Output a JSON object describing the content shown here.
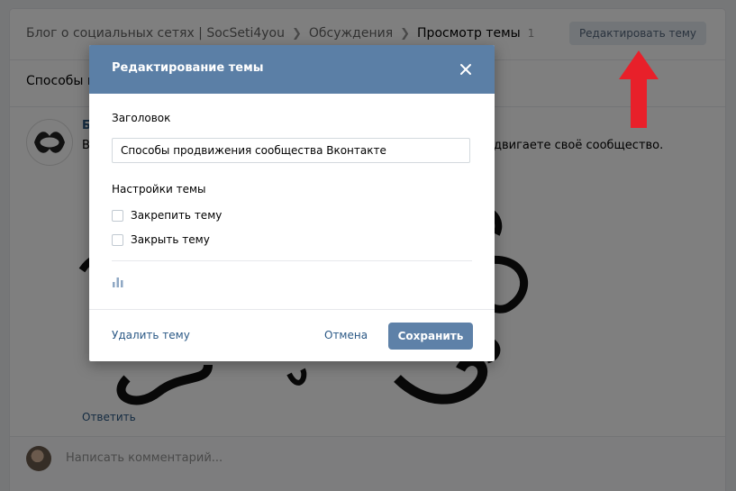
{
  "breadcrumbs": {
    "group": "Блог о социальных сетях | SocSeti4you",
    "section": "Обсуждения",
    "current": "Просмотр темы",
    "count": "1"
  },
  "header": {
    "edit_topic_label": "Редактировать тему"
  },
  "topic": {
    "title_partial": "Способы п"
  },
  "post": {
    "author_partial": "Б",
    "text_left": "В",
    "text_right": "двигаете своё сообщество."
  },
  "reply_label": "Ответить",
  "composer": {
    "placeholder": "Написать комментарий..."
  },
  "modal": {
    "title": "Редактирование темы",
    "heading_label": "Заголовок",
    "title_value": "Способы продвижения сообщества Вконтакте",
    "settings_label": "Настройки темы",
    "pin_label": "Закрепить тему",
    "close_label": "Закрыть тему",
    "delete_label": "Удалить тему",
    "cancel_label": "Отмена",
    "save_label": "Сохранить"
  },
  "colors": {
    "modal_header": "#5b7fa6",
    "save_button": "#5e81a8",
    "link": "#2a5885",
    "annotation_arrow": "#e8202a"
  },
  "icons": {
    "close": "close-icon",
    "poll": "poll-icon",
    "arrow": "arrow-up-icon"
  }
}
